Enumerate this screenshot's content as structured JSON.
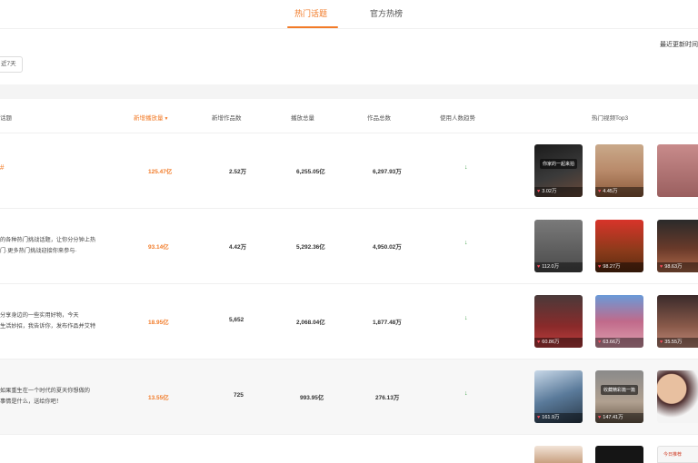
{
  "tabs": [
    {
      "label": "热门话题",
      "active": true
    },
    {
      "label": "官方热榜",
      "active": false
    }
  ],
  "update_note": "最近更新时间",
  "filter_chip": "近7天",
  "table": {
    "headers": [
      "话题",
      "新增播放量",
      "新增作品数",
      "播放总量",
      "作品总数",
      "使用人数趋势",
      "热门视频Top3"
    ],
    "sort_arrow": "▼",
    "rows": [
      {
        "desc": [
          "#"
        ],
        "new_plays": "125.47亿",
        "new_works": "2.52万",
        "total_plays": "6,255.05亿",
        "total_works": "6,297.93万",
        "trend": "↓",
        "videos": [
          {
            "plays": "3.02万",
            "caption": "你家的一起来拍"
          },
          {
            "plays": "4.45万",
            "caption": ""
          },
          {
            "plays": "",
            "caption": ""
          }
        ]
      },
      {
        "desc": [
          "的各种热门挑战话题，让你分分钟上热",
          "门·更多热门挑战迎接你来参与·"
        ],
        "new_plays": "93.14亿",
        "new_works": "4.42万",
        "total_plays": "5,292.36亿",
        "total_works": "4,950.02万",
        "trend": "↓",
        "videos": [
          {
            "plays": "112.0万",
            "caption": ""
          },
          {
            "plays": "98.27万",
            "caption": ""
          },
          {
            "plays": "98.63万",
            "caption": ""
          }
        ]
      },
      {
        "desc": [
          "分享身边的一些实用好物，今天",
          "生活妙招，我告诉你，发布作品并艾特"
        ],
        "new_plays": "18.95亿",
        "new_works": "5,652",
        "total_plays": "2,068.04亿",
        "total_works": "1,877.48万",
        "trend": "↓",
        "videos": [
          {
            "plays": "60.86万",
            "caption": ""
          },
          {
            "plays": "63.66万",
            "caption": ""
          },
          {
            "plays": "35.55万",
            "caption": ""
          }
        ]
      },
      {
        "desc": [
          "如果重生在一个时代的夏天你想做的",
          "事情是什么，送给你吧！"
        ],
        "new_plays": "13.55亿",
        "new_works": "725",
        "total_plays": "993.95亿",
        "total_works": "276.13万",
        "trend": "↓",
        "videos": [
          {
            "plays": "161.9万",
            "caption": ""
          },
          {
            "plays": "147.41万",
            "caption": "收藏精彩篇一篇"
          },
          {
            "plays": "",
            "caption": ""
          }
        ]
      },
      {
        "desc": [
          ""
        ],
        "new_plays": "",
        "new_works": "",
        "total_plays": "",
        "total_works": "",
        "trend": "",
        "videos": [
          {
            "plays": "",
            "caption": ""
          },
          {
            "plays": "",
            "caption": ""
          },
          {
            "plays": "",
            "caption": "今日推荐"
          }
        ]
      }
    ]
  },
  "colors": {
    "accent": "#f27b28",
    "trend_green": "#3a9d44",
    "row_alt": "#f7f7f7"
  },
  "icons": {
    "sort": "sort-desc-icon",
    "trend": "trend-arrow-icon",
    "likes": "heart-icon"
  }
}
